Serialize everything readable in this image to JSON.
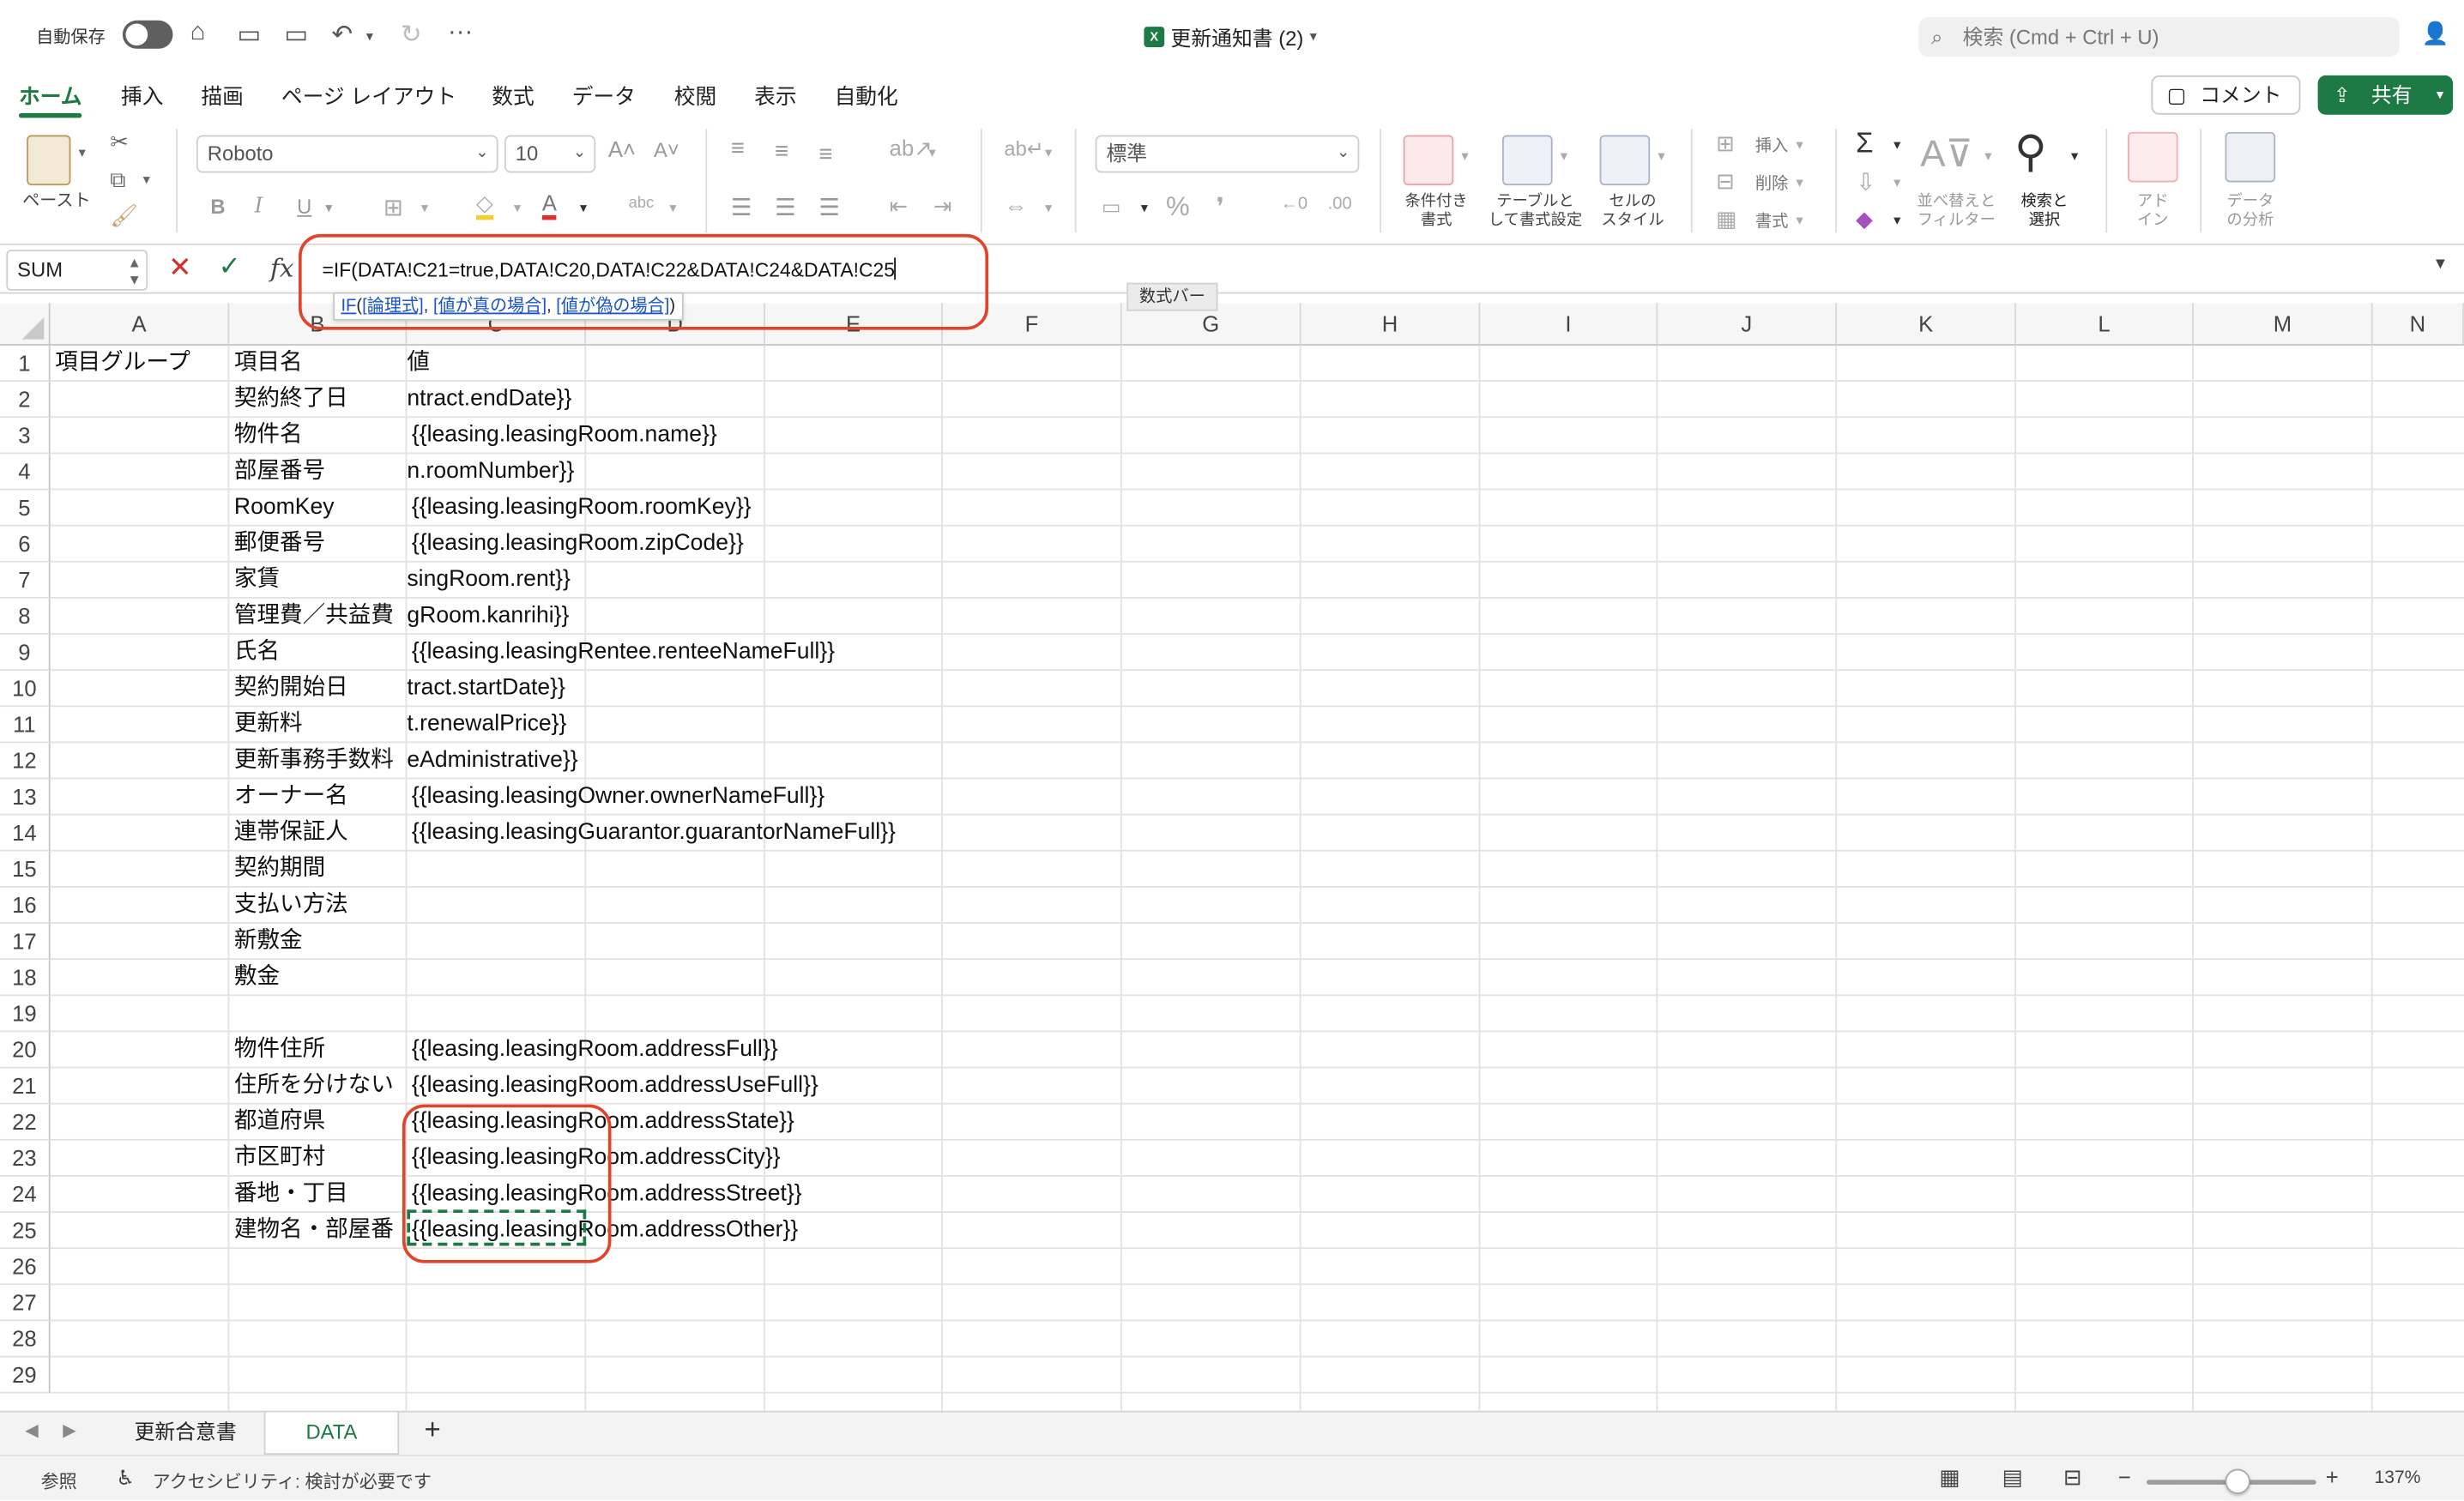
{
  "titlebar": {
    "autosave_label": "自動保存",
    "doc_title": "更新通知書 (2)",
    "search_placeholder": "検索 (Cmd + Ctrl + U)"
  },
  "ribbon_tabs": [
    "ホーム",
    "挿入",
    "描画",
    "ページ レイアウト",
    "数式",
    "データ",
    "校閲",
    "表示",
    "自動化"
  ],
  "actions": {
    "comment": "コメント",
    "share": "共有"
  },
  "ribbon": {
    "paste": "ペースト",
    "font_name": "Roboto",
    "font_size": "10",
    "bold": "B",
    "italic": "I",
    "underline": "U",
    "number_format": "標準",
    "percent": "%",
    "insert": "挿入",
    "delete": "削除",
    "format": "書式",
    "cond_format": [
      "条件付き",
      "書式"
    ],
    "table_format": [
      "テーブルと",
      "して書式設定"
    ],
    "cell_style": [
      "セルの",
      "スタイル"
    ],
    "sort_filter": [
      "並べ替えと",
      "フィルター"
    ],
    "find_select": [
      "検索と",
      "選択"
    ],
    "addins": [
      "アド",
      "イン"
    ],
    "analyze": [
      "データ",
      "の分析"
    ]
  },
  "formula_bar": {
    "name_box": "SUM",
    "formula": "=IF(DATA!C21=true,DATA!C20,DATA!C22&DATA!C24&DATA!C25",
    "hint": {
      "func": "IF",
      "arg1": "[論理式]",
      "arg2": "[値が真の場合]",
      "arg3": "[値が偽の場合]"
    },
    "tooltip": "数式バー"
  },
  "columns": [
    "A",
    "B",
    "C",
    "D",
    "E",
    "F",
    "G",
    "H",
    "I",
    "J",
    "K",
    "L",
    "M",
    "N"
  ],
  "rows": [
    {
      "n": "1",
      "a": "項目グループ",
      "b": "項目名",
      "c": "値"
    },
    {
      "n": "2",
      "a": "",
      "b": "契約終了日",
      "c": "ntract.endDate}}"
    },
    {
      "n": "3",
      "a": "",
      "b": "物件名",
      "c": "{{leasing.leasingRoom.name}}"
    },
    {
      "n": "4",
      "a": "",
      "b": "部屋番号",
      "c": "n.roomNumber}}"
    },
    {
      "n": "5",
      "a": "",
      "b": "RoomKey",
      "c": "{{leasing.leasingRoom.roomKey}}"
    },
    {
      "n": "6",
      "a": "",
      "b": "郵便番号",
      "c": "{{leasing.leasingRoom.zipCode}}"
    },
    {
      "n": "7",
      "a": "",
      "b": "家賃",
      "c": "singRoom.rent}}"
    },
    {
      "n": "8",
      "a": "",
      "b": "管理費／共益費",
      "c": "gRoom.kanrihi}}"
    },
    {
      "n": "9",
      "a": "",
      "b": "氏名",
      "c": "{{leasing.leasingRentee.renteeNameFull}}"
    },
    {
      "n": "10",
      "a": "",
      "b": "契約開始日",
      "c": "tract.startDate}}"
    },
    {
      "n": "11",
      "a": "",
      "b": "更新料",
      "c": "t.renewalPrice}}"
    },
    {
      "n": "12",
      "a": "",
      "b": "更新事務手数料",
      "c": "eAdministrative}}"
    },
    {
      "n": "13",
      "a": "",
      "b": "オーナー名",
      "c": "{{leasing.leasingOwner.ownerNameFull}}"
    },
    {
      "n": "14",
      "a": "",
      "b": "連帯保証人",
      "c": "{{leasing.leasingGuarantor.guarantorNameFull}}"
    },
    {
      "n": "15",
      "a": "",
      "b": "契約期間",
      "c": ""
    },
    {
      "n": "16",
      "a": "",
      "b": "支払い方法",
      "c": ""
    },
    {
      "n": "17",
      "a": "",
      "b": "新敷金",
      "c": ""
    },
    {
      "n": "18",
      "a": "",
      "b": "敷金",
      "c": ""
    },
    {
      "n": "19",
      "a": "",
      "b": "",
      "c": ""
    },
    {
      "n": "20",
      "a": "",
      "b": "物件住所",
      "c": "{{leasing.leasingRoom.addressFull}}"
    },
    {
      "n": "21",
      "a": "",
      "b": "住所を分けない",
      "c": "{{leasing.leasingRoom.addressUseFull}}"
    },
    {
      "n": "22",
      "a": "",
      "b": "都道府県",
      "c": "{{leasing.leasingRoom.addressState}}"
    },
    {
      "n": "23",
      "a": "",
      "b": "市区町村",
      "c": "{{leasing.leasingRoom.addressCity}}"
    },
    {
      "n": "24",
      "a": "",
      "b": "番地・丁目",
      "c": "{{leasing.leasingRoom.addressStreet}}"
    },
    {
      "n": "25",
      "a": "",
      "b": "建物名・部屋番",
      "c": "{{leasing.leasingRoom.addressOther}}"
    },
    {
      "n": "26",
      "a": "",
      "b": "",
      "c": ""
    },
    {
      "n": "27",
      "a": "",
      "b": "",
      "c": ""
    },
    {
      "n": "28",
      "a": "",
      "b": "",
      "c": ""
    },
    {
      "n": "29",
      "a": "",
      "b": "",
      "c": ""
    }
  ],
  "sheets": [
    "更新合意書",
    "DATA"
  ],
  "status": {
    "mode": "参照",
    "accessibility": "アクセシビリティ: 検討が必要です",
    "zoom": "137%"
  }
}
